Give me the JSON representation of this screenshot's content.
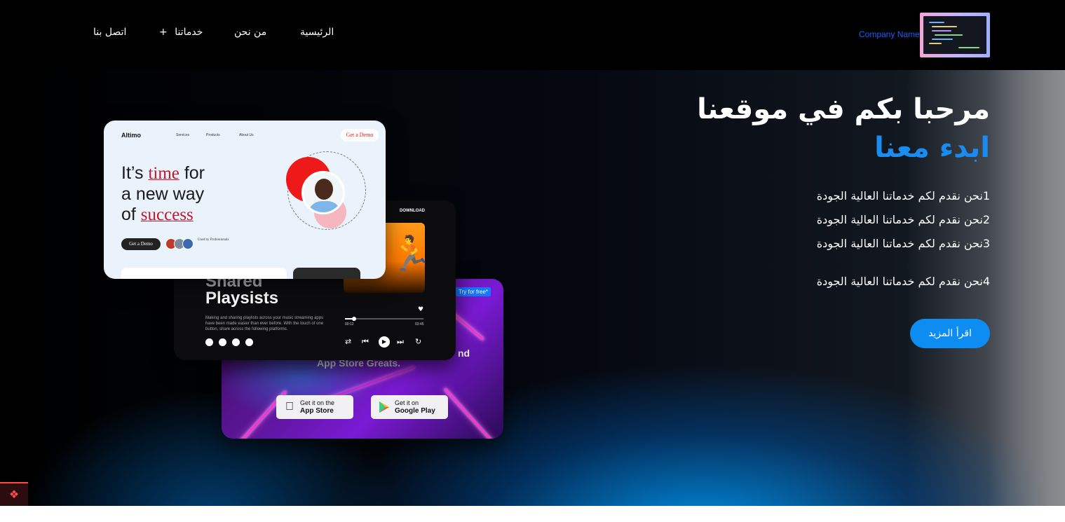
{
  "header": {
    "brand_name": "Company Name",
    "nav": [
      {
        "label": "الرئيسية"
      },
      {
        "label": "من نحن"
      },
      {
        "label": "خدماتنا"
      },
      {
        "label": "اتصل بنا"
      }
    ],
    "dropdown_marker": "+"
  },
  "hero": {
    "title": "مرحبا بكم في موقعنا",
    "subtitle": "ابدء معنا",
    "features": [
      "1نحن نقدم لكم خدماتنا العالية الجودة",
      "2نحن نقدم لكم خدماتنا العالية الجودة",
      "3نحن نقدم لكم خدماتنا العالية الجودة",
      "4نحن نقدم لكم خدماتنا العالية الجودة"
    ],
    "cta_label": "اقرأ المزيد"
  },
  "mockups": {
    "altimo": {
      "brand": "Altimo",
      "nav": [
        "Services",
        "Products",
        "About Us"
      ],
      "demo_label": "Get a Demo",
      "headline_1a": "It’s ",
      "headline_1b": "time",
      "headline_1c": " for",
      "headline_2": "a new way",
      "headline_3a": "of ",
      "headline_3b": "success",
      "cta_label": "Get a Demo",
      "used_by": "Used by Professionals"
    },
    "playlist": {
      "title_top": "Shared",
      "title_main": "Playsists",
      "body": "Making and sharing playlists across your music streaming apps have been made easier than ever before. With the touch of one button, share across the following platforms.",
      "download_label": "DOWNLOAD",
      "progress": 0.12,
      "time_elapsed": "00:12",
      "time_total": "03:45"
    },
    "store": {
      "try_label": "Try for free*",
      "tagline_tail": "nd",
      "tagline": "App Store Greats.",
      "appstore_small": "Get it on the",
      "appstore_big": "App Store",
      "googleplay_small": "Get it on",
      "googleplay_big": "Google Play"
    }
  },
  "icons": {
    "apple": "apple-icon",
    "play": "google-play-icon",
    "corner": "laravel-icon"
  },
  "colors": {
    "accent": "#0d8cf1",
    "subtitle": "#1a8cf0",
    "brand_text": "#1f5cff"
  }
}
